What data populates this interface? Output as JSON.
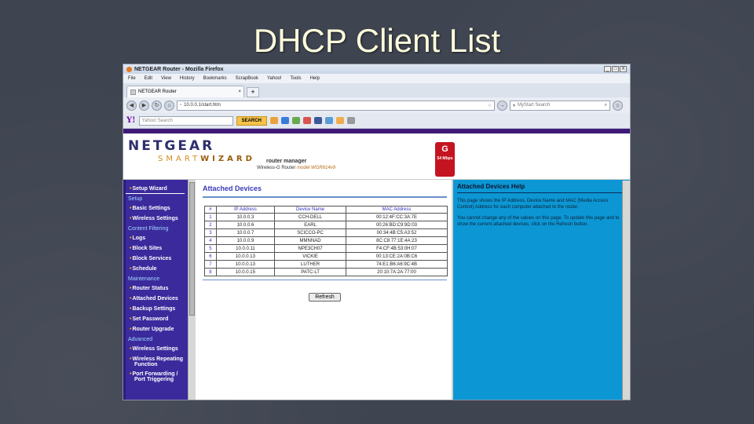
{
  "slide": {
    "title": "DHCP Client List"
  },
  "browser": {
    "window_title": "NETGEAR Router - Mozilla Firefox",
    "window_buttons": [
      "_",
      "□",
      "X"
    ],
    "menu": [
      "File",
      "Edit",
      "View",
      "History",
      "Bookmarks",
      "ScrapBook",
      "Yahoo!",
      "Tools",
      "Help"
    ],
    "tab_title": "NETGEAR Router",
    "tab_close": "×",
    "new_tab": "+",
    "url": "10.0.0.1/start.htm",
    "search_placeholder": "MyStart Search",
    "yahoo_logo": "Y!",
    "yahoo_search_placeholder": "Yahoo! Search",
    "yahoo_search_button": "SEARCH"
  },
  "router": {
    "brand": "NETGEAR",
    "smart": "SMART",
    "wizard": "WIZARD",
    "router_manager": "router manager",
    "model_prefix": "Wireless-G Router",
    "model": "model WGR614v9",
    "badge": "G",
    "badge_sub": "54 Mbps"
  },
  "sidebar": {
    "setup_wizard": "Setup Wizard",
    "sections": [
      {
        "title": "Setup",
        "items": [
          "Basic Settings",
          "Wireless Settings"
        ]
      },
      {
        "title": "Content Filtering",
        "items": [
          "Logs",
          "Block Sites",
          "Block Services",
          "Schedule"
        ]
      },
      {
        "title": "Maintenance",
        "items": [
          "Router Status",
          "Attached Devices",
          "Backup Settings",
          "Set Password",
          "Router Upgrade"
        ]
      },
      {
        "title": "Advanced",
        "items": [
          "Wireless Settings",
          "Wireless Repeating",
          "Port Forwarding /"
        ]
      }
    ],
    "wireless_repeating_cont": "Function",
    "port_forwarding_cont": "Port Triggering"
  },
  "main": {
    "title": "Attached Devices",
    "columns": [
      "#",
      "IP Address",
      "Device Name",
      "MAC Address"
    ],
    "rows": [
      [
        "1",
        "10.0.0.3",
        "CCH-DELL",
        "00:12:4F:CC:3A:7E"
      ],
      [
        "2",
        "10.0.0.6",
        "EARL",
        "00:26:BD:C9:9D:03"
      ],
      [
        "3",
        "10.0.0.7",
        "SCICCO-PC",
        "00:34:4B:C5:A3:52"
      ],
      [
        "4",
        "10.0.0.9",
        "MMNNAD",
        "8C:C8:77:1E:4A:23"
      ],
      [
        "5",
        "10.0.0.11",
        "NPE3CH07",
        "F4:CF:4B:53:0H:07"
      ],
      [
        "6",
        "10.0.0.13",
        "VICKIE",
        "00:13:CE:2A:0B:C6"
      ],
      [
        "7",
        "10.0.0.13",
        "LUTHER",
        "74:E1:B6:A6:9C:4B"
      ],
      [
        "8",
        "10.0.0.15",
        "PATC-LT",
        "20:10:7A:2A:77:00"
      ]
    ],
    "refresh_label": "Refresh"
  },
  "help": {
    "title": "Attached Devices Help",
    "para1": "This page shows the IP Address, Device Name and MAC (Media Access Control) Address for each computer attached to the router.",
    "para2": "You cannot change any of the values on this page. To update this page and to show the current attached devices, click on the Refresh button."
  },
  "colors": {
    "slide_bg": "#3f4451",
    "title": "#ffffdc",
    "sidebar": "#3b2a9c",
    "help_bg": "#0c97d4",
    "netgear_orange": "#d78b1f"
  }
}
